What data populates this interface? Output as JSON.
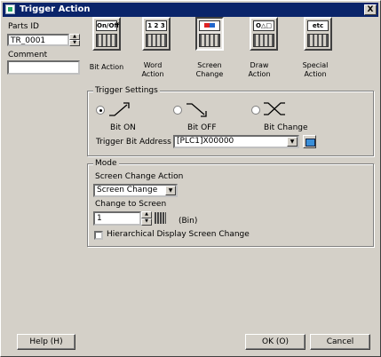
{
  "window": {
    "title": "Trigger Action",
    "close_label": "X"
  },
  "left": {
    "parts_id_label": "Parts ID",
    "parts_id_value": "TR_0001",
    "comment_label": "Comment",
    "comment_value": ""
  },
  "toolbar": [
    {
      "face": "On/Off",
      "label": "Bit Action",
      "icon": "bit-action-icon"
    },
    {
      "face": "1 2 3",
      "label": "Word Action",
      "icon": "word-action-icon"
    },
    {
      "face": "",
      "label": "Screen Change",
      "icon": "screen-change-icon"
    },
    {
      "face": "O△□",
      "label": "Draw Action",
      "icon": "draw-action-icon"
    },
    {
      "face": "etc",
      "label": "Special Action",
      "icon": "special-action-icon"
    }
  ],
  "trigger": {
    "title": "Trigger Settings",
    "options": [
      {
        "label": "Bit ON",
        "selected": true,
        "icon": "bit-on-icon"
      },
      {
        "label": "Bit OFF",
        "selected": false,
        "icon": "bit-off-icon"
      },
      {
        "label": "Bit Change",
        "selected": false,
        "icon": "bit-change-icon"
      }
    ],
    "address_label": "Trigger Bit Address",
    "address_value": "[PLC1]X00000"
  },
  "mode": {
    "title": "Mode",
    "action_label": "Screen Change Action",
    "action_value": "Screen Change",
    "change_to_label": "Change to Screen",
    "change_to_value": "1",
    "change_to_unit": "(Bin)",
    "hier_label": "Hierarchical Display Screen Change",
    "hier_checked": false
  },
  "buttons": {
    "help": "Help (H)",
    "ok": "OK (O)",
    "cancel": "Cancel"
  }
}
